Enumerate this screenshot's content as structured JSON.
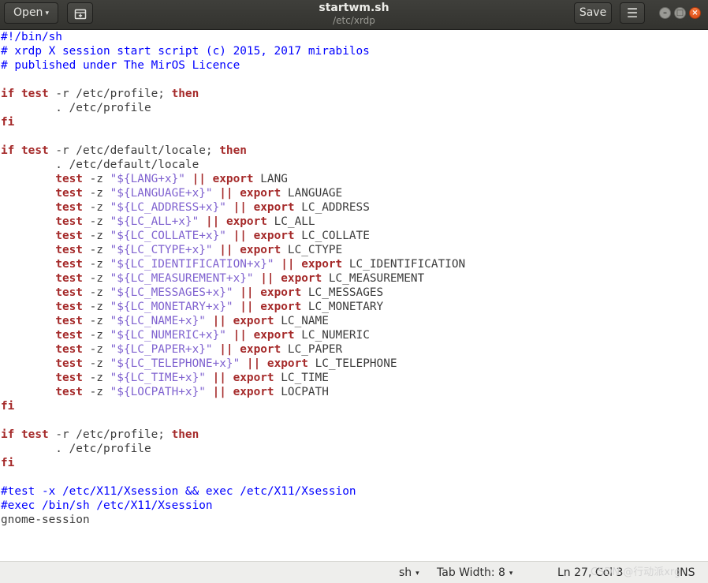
{
  "header": {
    "open_label": "Open",
    "open_caret": "▾",
    "title": "startwm.sh",
    "subtitle": "/etc/xrdp",
    "save_label": "Save",
    "menu_icon": "☰",
    "minimize_icon": "–",
    "maximize_icon": "□",
    "close_icon": "×"
  },
  "editor": {
    "lines": [
      [
        [
          "cm",
          "#!/bin/sh"
        ]
      ],
      [
        [
          "cm",
          "# xrdp X session start script (c) 2015, 2017 mirabilos"
        ]
      ],
      [
        [
          "cm",
          "# published under The MirOS Licence"
        ]
      ],
      [],
      [
        [
          "kw",
          "if"
        ],
        [
          "pl",
          " "
        ],
        [
          "kw",
          "test"
        ],
        [
          "pl",
          " -r /etc/profile; "
        ],
        [
          "kw",
          "then"
        ]
      ],
      [
        [
          "pl",
          "        . /etc/profile"
        ]
      ],
      [
        [
          "kw",
          "fi"
        ]
      ],
      [],
      [
        [
          "kw",
          "if"
        ],
        [
          "pl",
          " "
        ],
        [
          "kw",
          "test"
        ],
        [
          "pl",
          " -r /etc/default/locale; "
        ],
        [
          "kw",
          "then"
        ]
      ],
      [
        [
          "pl",
          "        . /etc/default/locale"
        ]
      ],
      [
        [
          "pl",
          "        "
        ],
        [
          "kw",
          "test"
        ],
        [
          "pl",
          " -z "
        ],
        [
          "str",
          "\"${LANG+x}\""
        ],
        [
          "pl",
          " "
        ],
        [
          "kw",
          "||"
        ],
        [
          "pl",
          " "
        ],
        [
          "kw",
          "export"
        ],
        [
          "pl",
          " LANG"
        ]
      ],
      [
        [
          "pl",
          "        "
        ],
        [
          "kw",
          "test"
        ],
        [
          "pl",
          " -z "
        ],
        [
          "str",
          "\"${LANGUAGE+x}\""
        ],
        [
          "pl",
          " "
        ],
        [
          "kw",
          "||"
        ],
        [
          "pl",
          " "
        ],
        [
          "kw",
          "export"
        ],
        [
          "pl",
          " LANGUAGE"
        ]
      ],
      [
        [
          "pl",
          "        "
        ],
        [
          "kw",
          "test"
        ],
        [
          "pl",
          " -z "
        ],
        [
          "str",
          "\"${LC_ADDRESS+x}\""
        ],
        [
          "pl",
          " "
        ],
        [
          "kw",
          "||"
        ],
        [
          "pl",
          " "
        ],
        [
          "kw",
          "export"
        ],
        [
          "pl",
          " LC_ADDRESS"
        ]
      ],
      [
        [
          "pl",
          "        "
        ],
        [
          "kw",
          "test"
        ],
        [
          "pl",
          " -z "
        ],
        [
          "str",
          "\"${LC_ALL+x}\""
        ],
        [
          "pl",
          " "
        ],
        [
          "kw",
          "||"
        ],
        [
          "pl",
          " "
        ],
        [
          "kw",
          "export"
        ],
        [
          "pl",
          " LC_ALL"
        ]
      ],
      [
        [
          "pl",
          "        "
        ],
        [
          "kw",
          "test"
        ],
        [
          "pl",
          " -z "
        ],
        [
          "str",
          "\"${LC_COLLATE+x}\""
        ],
        [
          "pl",
          " "
        ],
        [
          "kw",
          "||"
        ],
        [
          "pl",
          " "
        ],
        [
          "kw",
          "export"
        ],
        [
          "pl",
          " LC_COLLATE"
        ]
      ],
      [
        [
          "pl",
          "        "
        ],
        [
          "kw",
          "test"
        ],
        [
          "pl",
          " -z "
        ],
        [
          "str",
          "\"${LC_CTYPE+x}\""
        ],
        [
          "pl",
          " "
        ],
        [
          "kw",
          "||"
        ],
        [
          "pl",
          " "
        ],
        [
          "kw",
          "export"
        ],
        [
          "pl",
          " LC_CTYPE"
        ]
      ],
      [
        [
          "pl",
          "        "
        ],
        [
          "kw",
          "test"
        ],
        [
          "pl",
          " -z "
        ],
        [
          "str",
          "\"${LC_IDENTIFICATION+x}\""
        ],
        [
          "pl",
          " "
        ],
        [
          "kw",
          "||"
        ],
        [
          "pl",
          " "
        ],
        [
          "kw",
          "export"
        ],
        [
          "pl",
          " LC_IDENTIFICATION"
        ]
      ],
      [
        [
          "pl",
          "        "
        ],
        [
          "kw",
          "test"
        ],
        [
          "pl",
          " -z "
        ],
        [
          "str",
          "\"${LC_MEASUREMENT+x}\""
        ],
        [
          "pl",
          " "
        ],
        [
          "kw",
          "||"
        ],
        [
          "pl",
          " "
        ],
        [
          "kw",
          "export"
        ],
        [
          "pl",
          " LC_MEASUREMENT"
        ]
      ],
      [
        [
          "pl",
          "        "
        ],
        [
          "kw",
          "test"
        ],
        [
          "pl",
          " -z "
        ],
        [
          "str",
          "\"${LC_MESSAGES+x}\""
        ],
        [
          "pl",
          " "
        ],
        [
          "kw",
          "||"
        ],
        [
          "pl",
          " "
        ],
        [
          "kw",
          "export"
        ],
        [
          "pl",
          " LC_MESSAGES"
        ]
      ],
      [
        [
          "pl",
          "        "
        ],
        [
          "kw",
          "test"
        ],
        [
          "pl",
          " -z "
        ],
        [
          "str",
          "\"${LC_MONETARY+x}\""
        ],
        [
          "pl",
          " "
        ],
        [
          "kw",
          "||"
        ],
        [
          "pl",
          " "
        ],
        [
          "kw",
          "export"
        ],
        [
          "pl",
          " LC_MONETARY"
        ]
      ],
      [
        [
          "pl",
          "        "
        ],
        [
          "kw",
          "test"
        ],
        [
          "pl",
          " -z "
        ],
        [
          "str",
          "\"${LC_NAME+x}\""
        ],
        [
          "pl",
          " "
        ],
        [
          "kw",
          "||"
        ],
        [
          "pl",
          " "
        ],
        [
          "kw",
          "export"
        ],
        [
          "pl",
          " LC_NAME"
        ]
      ],
      [
        [
          "pl",
          "        "
        ],
        [
          "kw",
          "test"
        ],
        [
          "pl",
          " -z "
        ],
        [
          "str",
          "\"${LC_NUMERIC+x}\""
        ],
        [
          "pl",
          " "
        ],
        [
          "kw",
          "||"
        ],
        [
          "pl",
          " "
        ],
        [
          "kw",
          "export"
        ],
        [
          "pl",
          " LC_NUMERIC"
        ]
      ],
      [
        [
          "pl",
          "        "
        ],
        [
          "kw",
          "test"
        ],
        [
          "pl",
          " -z "
        ],
        [
          "str",
          "\"${LC_PAPER+x}\""
        ],
        [
          "pl",
          " "
        ],
        [
          "kw",
          "||"
        ],
        [
          "pl",
          " "
        ],
        [
          "kw",
          "export"
        ],
        [
          "pl",
          " LC_PAPER"
        ]
      ],
      [
        [
          "pl",
          "        "
        ],
        [
          "kw",
          "test"
        ],
        [
          "pl",
          " -z "
        ],
        [
          "str",
          "\"${LC_TELEPHONE+x}\""
        ],
        [
          "pl",
          " "
        ],
        [
          "kw",
          "||"
        ],
        [
          "pl",
          " "
        ],
        [
          "kw",
          "export"
        ],
        [
          "pl",
          " LC_TELEPHONE"
        ]
      ],
      [
        [
          "pl",
          "        "
        ],
        [
          "kw",
          "test"
        ],
        [
          "pl",
          " -z "
        ],
        [
          "str",
          "\"${LC_TIME+x}\""
        ],
        [
          "pl",
          " "
        ],
        [
          "kw",
          "||"
        ],
        [
          "pl",
          " "
        ],
        [
          "kw",
          "export"
        ],
        [
          "pl",
          " LC_TIME"
        ]
      ],
      [
        [
          "pl",
          "        "
        ],
        [
          "kw",
          "test"
        ],
        [
          "pl",
          " -z "
        ],
        [
          "str",
          "\"${LOCPATH+x}\""
        ],
        [
          "pl",
          " "
        ],
        [
          "kw",
          "||"
        ],
        [
          "pl",
          " "
        ],
        [
          "kw",
          "export"
        ],
        [
          "pl",
          " LOCPATH"
        ]
      ],
      [
        [
          "kw",
          "fi"
        ]
      ],
      [],
      [
        [
          "kw",
          "if"
        ],
        [
          "pl",
          " "
        ],
        [
          "kw",
          "test"
        ],
        [
          "pl",
          " -r /etc/profile; "
        ],
        [
          "kw",
          "then"
        ]
      ],
      [
        [
          "pl",
          "        . /etc/profile"
        ]
      ],
      [
        [
          "kw",
          "fi"
        ]
      ],
      [],
      [
        [
          "cm",
          "#test -x /etc/X11/Xsession && exec /etc/X11/Xsession"
        ]
      ],
      [
        [
          "cm",
          "#exec /bin/sh /etc/X11/Xsession"
        ]
      ],
      [
        [
          "pl",
          "gnome-session"
        ]
      ]
    ]
  },
  "statusbar": {
    "language": "sh",
    "tab_width": "Tab Width: 8",
    "cursor_position": "Ln 27, Col 3",
    "insert_mode": "INS",
    "caret": "▾",
    "watermark": "CSDN @行动派xrg"
  }
}
